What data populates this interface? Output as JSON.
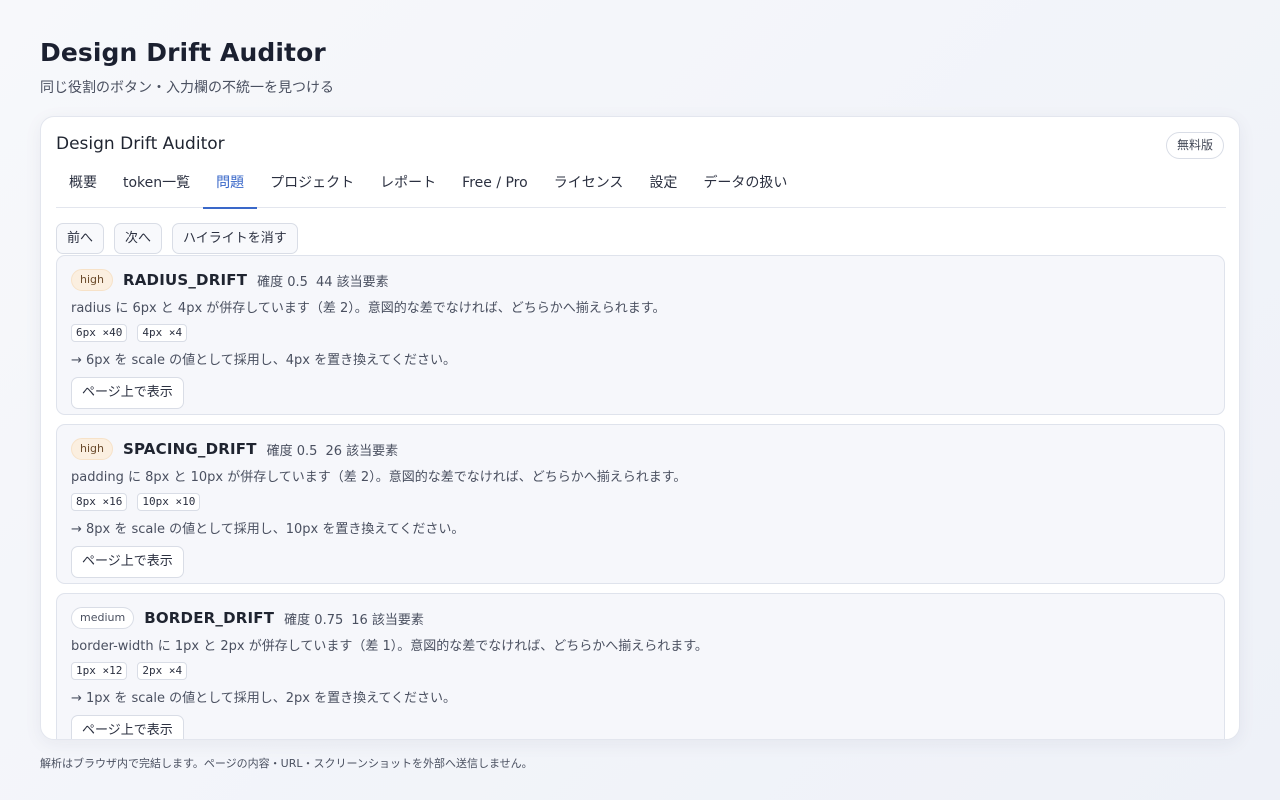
{
  "header": {
    "title": "Design Drift Auditor",
    "subtitle": "同じ役割のボタン・入力欄の不統一を見つける"
  },
  "panel": {
    "title": "Design Drift Auditor",
    "plan_badge": "無料版",
    "tabs": [
      {
        "label": "概要"
      },
      {
        "label": "token一覧"
      },
      {
        "label": "問題",
        "active": true
      },
      {
        "label": "プロジェクト"
      },
      {
        "label": "レポート"
      },
      {
        "label": "Free / Pro"
      },
      {
        "label": "ライセンス"
      },
      {
        "label": "設定"
      },
      {
        "label": "データの扱い"
      }
    ],
    "toolbar": {
      "prev_label": "前へ",
      "next_label": "次へ",
      "clear_label": "ハイライトを消す"
    },
    "issues": [
      {
        "severity": "high",
        "code": "RADIUS_DRIFT",
        "confidence": "確度 0.5",
        "count": "44 該当要素",
        "description": "radius に 6px と 4px が併存しています（差 2）。意図的な差でなければ、どちらかへ揃えられます。",
        "chips": [
          "6px ×40",
          "4px ×4"
        ],
        "recommendation": "→ 6px を scale の値として採用し、4px を置き換えてください。",
        "show_label": "ページ上で表示"
      },
      {
        "severity": "high",
        "code": "SPACING_DRIFT",
        "confidence": "確度 0.5",
        "count": "26 該当要素",
        "description": "padding に 8px と 10px が併存しています（差 2）。意図的な差でなければ、どちらかへ揃えられます。",
        "chips": [
          "8px ×16",
          "10px ×10"
        ],
        "recommendation": "→ 8px を scale の値として採用し、10px を置き換えてください。",
        "show_label": "ページ上で表示"
      },
      {
        "severity": "medium",
        "code": "BORDER_DRIFT",
        "confidence": "確度 0.75",
        "count": "16 該当要素",
        "description": "border-width に 1px と 2px が併存しています（差 1）。意図的な差でなければ、どちらかへ揃えられます。",
        "chips": [
          "1px ×12",
          "2px ×4"
        ],
        "recommendation": "→ 1px を scale の値として採用し、2px を置き換えてください。",
        "show_label": "ページ上で表示"
      }
    ]
  },
  "footer": {
    "note": "解析はブラウザ内で完結します。ページの内容・URL・スクリーンショットを外部へ送信しません。"
  }
}
